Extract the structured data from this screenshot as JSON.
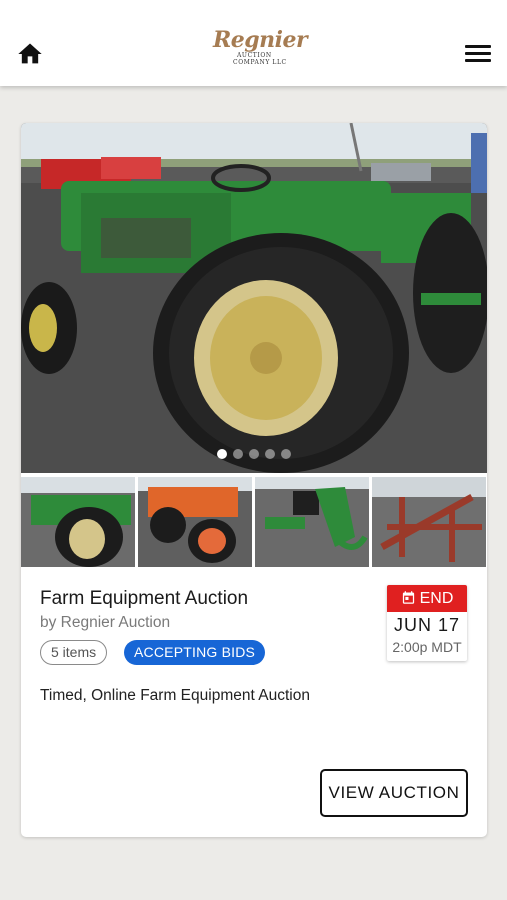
{
  "header": {
    "logo_text": "Regnier",
    "logo_sub1": "AUCTION",
    "logo_sub2": "COMPANY LLC",
    "home_icon": "home-icon",
    "menu_icon": "hamburger-menu-icon"
  },
  "auction": {
    "title": "Farm Equipment Auction",
    "byline": "by Regnier Auction",
    "items_count": "5 items",
    "status": "ACCEPTING BIDS",
    "description": "Timed, Online Farm Equipment Auction",
    "end_label": "END",
    "end_date": "JUN 17",
    "end_time": "2:00p MDT",
    "button_label": "VIEW AUCTION"
  },
  "carousel": {
    "slide_count": 5,
    "active_index": 0
  },
  "colors": {
    "status_chip": "#1766d6",
    "end_badge": "#e02020",
    "logo": "#a67c52",
    "background": "#ecebe8"
  }
}
